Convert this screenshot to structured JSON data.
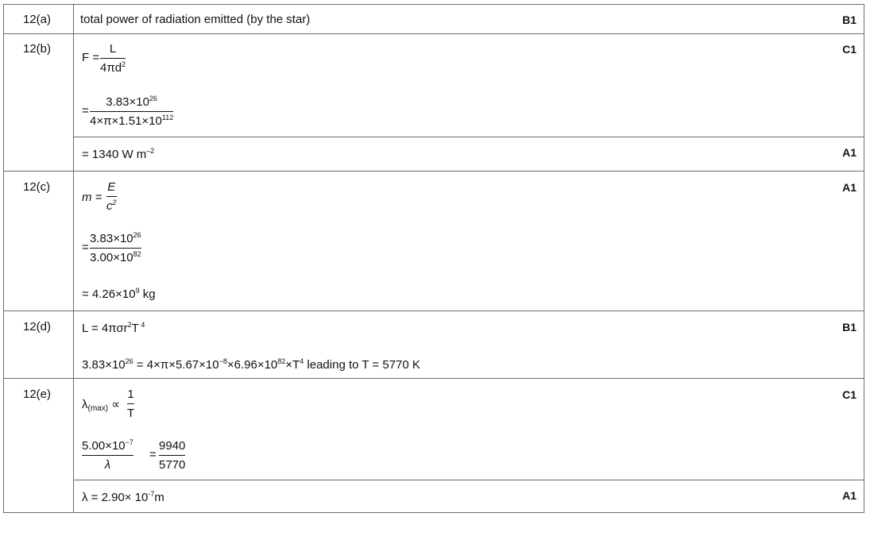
{
  "rows": [
    {
      "q": "12(a)",
      "mark": "B1",
      "text": "total power of radiation emitted (by the star)"
    },
    {
      "q": "12(b)",
      "mark1": "C1",
      "f1_lhs": "F =",
      "f1_num": "L",
      "f1_den_a": "4πd",
      "f1_den_sup": "2",
      "eq": "=",
      "f2_num_a": "3.83×10",
      "f2_num_sup": "26",
      "f2_den_a": "4×π×1.51×10",
      "f2_den_sup": "112",
      "ans_a": "= 1340 W m",
      "ans_sup": "–2",
      "mark2": "A1"
    },
    {
      "q": "12(c)",
      "mark": "A1",
      "m_lhs": "m =",
      "m_num": "E",
      "m_den": "c",
      "m_den_sup": "2",
      "eq": "=",
      "f_num_a": "3.83×10",
      "f_num_sup": "26",
      "f_den_a": "3.00×10",
      "f_den_sup": "82",
      "ans_a": "= 4.26×10",
      "ans_sup": "9",
      "ans_b": " kg"
    },
    {
      "q": "12(d)",
      "mark": "B1",
      "l_a": "L = 4πσr",
      "l_sup1": "2",
      "l_b": "T",
      "l_sup2": " 4",
      "line_a": "3.83×10",
      "line_sup1": "26",
      "line_b": " = 4×π×5.67×10",
      "line_sup2": "−8",
      "line_c": "×6.96×10",
      "line_sup3": "82",
      "line_d": "×T",
      "line_sup4": "4",
      "line_e": "  leading to T = 5770 K"
    },
    {
      "q": "12(e)",
      "mark1": "C1",
      "w_lhs": "λ",
      "w_sub": "(max)",
      "w_prop": " ∝",
      "w_num": "1",
      "w_den": "T",
      "r_num": "5.00×10",
      "r_num_sup": "−7",
      "r_den": "λ",
      "r_eq": "=",
      "r2_num": "9940",
      "r2_den": "5770",
      "ans_a": "λ = 2.90×  10",
      "ans_sup": "-7",
      "ans_b": "m",
      "mark2": "A1"
    }
  ]
}
